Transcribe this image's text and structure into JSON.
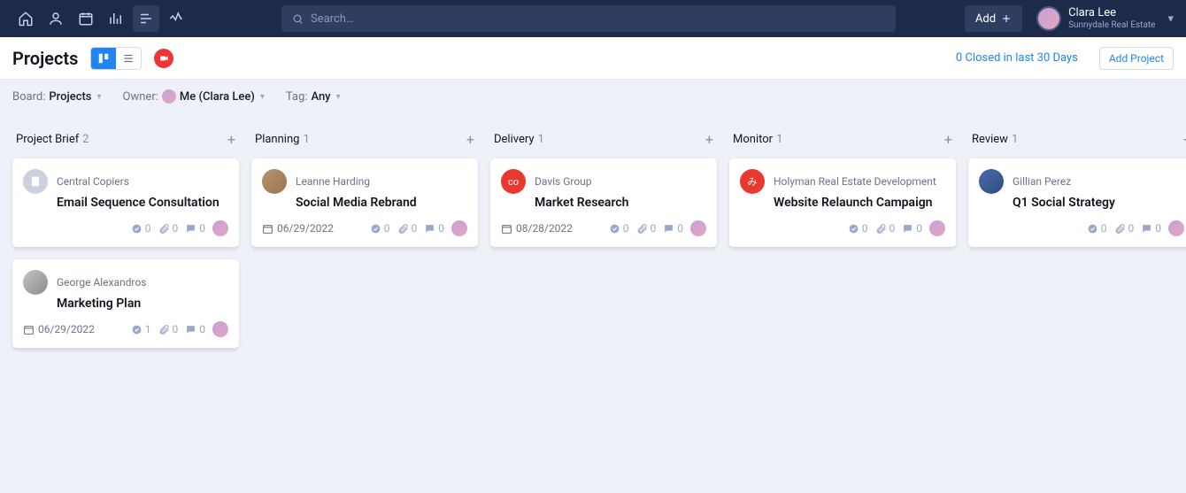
{
  "header": {
    "search_placeholder": "Search…",
    "add_label": "Add",
    "user_name": "Clara Lee",
    "user_org": "Sunnydale Real Estate"
  },
  "page": {
    "title": "Projects",
    "closed_text": "0 Closed in last 30 Days",
    "add_project_label": "Add Project"
  },
  "filters": {
    "board_label": "Board:",
    "board_value": "Projects",
    "owner_label": "Owner:",
    "owner_value": "Me (Clara Lee)",
    "tag_label": "Tag:",
    "tag_value": "Any"
  },
  "columns": [
    {
      "title": "Project Brief",
      "count": "2",
      "cards": [
        {
          "client": "Central Copiers",
          "title": "Email Sequence Consultation",
          "avatar_type": "icon",
          "date": "",
          "checks": "0",
          "attach": "0",
          "comments": "0"
        },
        {
          "client": "George Alexandros",
          "title": "Marketing Plan",
          "avatar_type": "photo3",
          "date": "06/29/2022",
          "checks": "1",
          "attach": "0",
          "comments": "0"
        }
      ]
    },
    {
      "title": "Planning",
      "count": "1",
      "cards": [
        {
          "client": "Leanne Harding",
          "title": "Social Media Rebrand",
          "avatar_type": "photo",
          "date": "06/29/2022",
          "checks": "0",
          "attach": "0",
          "comments": "0"
        }
      ]
    },
    {
      "title": "Delivery",
      "count": "1",
      "cards": [
        {
          "client": "Davis Group",
          "title": "Market Research",
          "avatar_type": "red",
          "avatar_text": "co",
          "date": "08/28/2022",
          "checks": "0",
          "attach": "0",
          "comments": "0"
        }
      ]
    },
    {
      "title": "Monitor",
      "count": "1",
      "cards": [
        {
          "client": "Holyman Real Estate Development",
          "title": "Website Relaunch Campaign",
          "avatar_type": "red",
          "avatar_text": "み",
          "date": "",
          "checks": "0",
          "attach": "0",
          "comments": "0"
        }
      ]
    },
    {
      "title": "Review",
      "count": "1",
      "cards": [
        {
          "client": "Gillian Perez",
          "title": "Q1 Social Strategy",
          "avatar_type": "photo2",
          "date": "",
          "checks": "0",
          "attach": "0",
          "comments": "0"
        }
      ]
    }
  ]
}
